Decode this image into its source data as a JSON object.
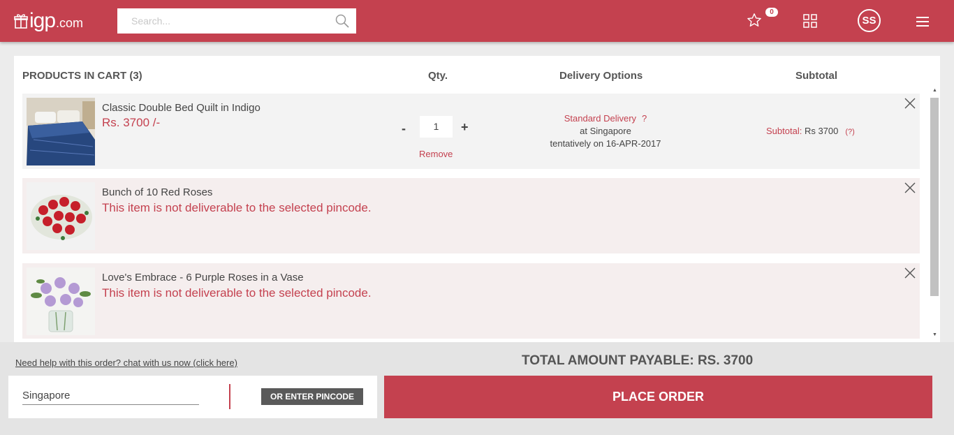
{
  "header": {
    "brand": "igp",
    "tld": ".com",
    "search_placeholder": "Search...",
    "wishlist_count": "0",
    "avatar_initials": "SS",
    "accent_color": "#c4414f"
  },
  "cart": {
    "headers": {
      "products": "PRODUCTS IN CART (3)",
      "qty": "Qty.",
      "delivery": "Delivery Options",
      "subtotal": "Subtotal"
    },
    "items": [
      {
        "name": "Classic Double Bed Quilt in Indigo",
        "price": "Rs. 3700 /-",
        "qty_minus": "-",
        "qty": "1",
        "qty_plus": "+",
        "remove": "Remove",
        "delivery_type": "Standard Delivery",
        "delivery_help": "?",
        "delivery_location": "at Singapore",
        "delivery_date": "tentatively on 16-APR-2017",
        "subtotal_label": "Subtotal: ",
        "subtotal_value": "Rs 3700",
        "subtotal_help": "(?)",
        "image_icon": "quilt-photo"
      },
      {
        "name": "Bunch of 10 Red Roses",
        "error": "This item is not deliverable to the selected pincode.",
        "image_icon": "red-roses-photo"
      },
      {
        "name": "Love's Embrace - 6 Purple Roses in a Vase",
        "error": "This item is not deliverable to the selected pincode.",
        "image_icon": "purple-roses-photo"
      }
    ]
  },
  "footer": {
    "help_link": "Need help with this order? chat with us now (click here)",
    "total": "TOTAL AMOUNT PAYABLE: RS. 3700",
    "location_value": "Singapore",
    "pincode_button": "OR ENTER PINCODE",
    "place_order": "PLACE ORDER"
  }
}
